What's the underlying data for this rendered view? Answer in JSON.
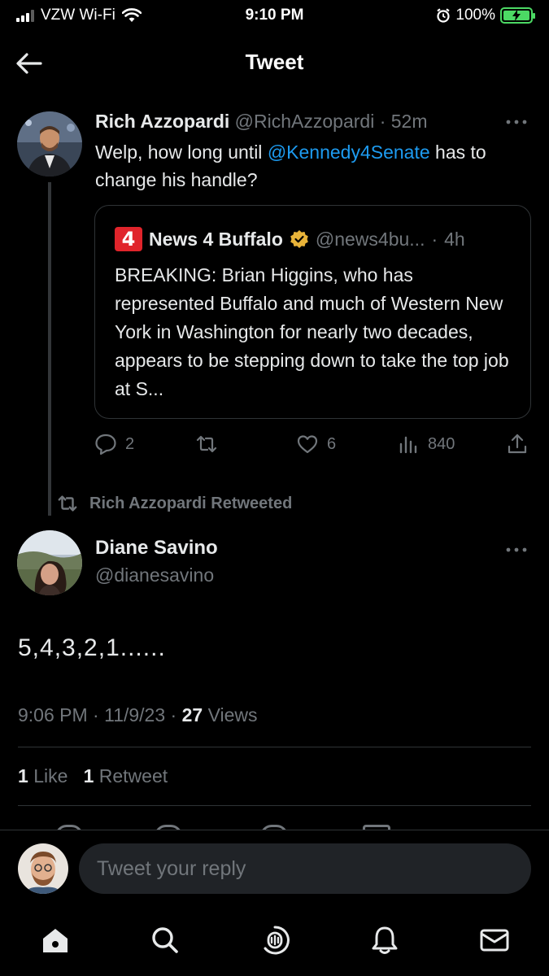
{
  "status_bar": {
    "carrier": "VZW Wi-Fi",
    "time": "9:10 PM",
    "battery": "100%"
  },
  "header": {
    "title": "Tweet"
  },
  "quoted_thread_tweet": {
    "name": "Rich Azzopardi",
    "handle": "@RichAzzopardi",
    "age": "52m",
    "text_before": "Welp, how long until ",
    "mention": "@Kennedy4Senate",
    "text_after": " has to change his handle?",
    "quote": {
      "logo": "4",
      "name": "News 4 Buffalo",
      "handle": "@news4bu...",
      "age": "4h",
      "text": "BREAKING: Brian Higgins, who has represented Buffalo and much of Western New York in Washington for nearly two decades, appears to be stepping down to take the top job at S..."
    },
    "actions": {
      "replies": "2",
      "retweets": "",
      "likes": "6",
      "views": "840"
    }
  },
  "retweet_notice": "Rich Azzopardi Retweeted",
  "main_tweet": {
    "name": "Diane Savino",
    "handle": "@dianesavino",
    "text": "5,4,3,2,1......",
    "time": "9:06 PM",
    "date": "11/9/23",
    "views_count": "27",
    "views_label": "Views",
    "likes_count": "1",
    "likes_label": "Like",
    "retweets_count": "1",
    "retweets_label": "Retweet"
  },
  "reply": {
    "placeholder": "Tweet your reply"
  },
  "colors": {
    "accent": "#1d9bf0",
    "muted": "#71767b",
    "verified": "#e8b339",
    "battery": "#4cd964",
    "news_logo": "#e0242b"
  },
  "icons": [
    "back-arrow-icon",
    "more-icon",
    "reply-icon",
    "retweet-icon",
    "like-icon",
    "views-icon",
    "share-icon",
    "home-icon",
    "search-icon",
    "spaces-icon",
    "notifications-icon",
    "messages-icon",
    "verified-badge-icon"
  ]
}
